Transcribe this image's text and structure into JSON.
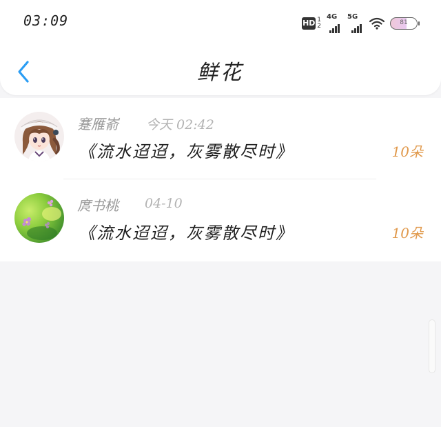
{
  "status_bar": {
    "time": "03:09",
    "hd_label": "HD",
    "hd_sub_top": "1",
    "hd_sub_bottom": "2",
    "signal_1_label": "4G",
    "signal_2_label": "5G",
    "battery_level": "81",
    "battery_fill_fraction": 0.6,
    "icons": [
      "hd-icon",
      "signal-4g-icon",
      "signal-5g-icon",
      "wifi-icon",
      "battery-icon"
    ]
  },
  "nav": {
    "back_icon": "chevron-left-icon",
    "title": "鲜花"
  },
  "messages": [
    {
      "name": "蹇雁嵛",
      "date": "今天 02:42",
      "text": "《流水迢迢，灰雾散尽时》",
      "count": "10朵",
      "avatar": "anime-girl-avatar"
    },
    {
      "name": "庹书桃",
      "date": "04-10",
      "text": "《流水迢迢，灰雾散尽时》",
      "count": "10朵",
      "avatar": "flower-photo-avatar"
    }
  ],
  "colors": {
    "accent_blue": "#2a9df4",
    "count_orange": "#e0984a",
    "name_gray": "#9a9a9a",
    "date_gray": "#b3b3b3",
    "background": "#f5f5f7"
  }
}
